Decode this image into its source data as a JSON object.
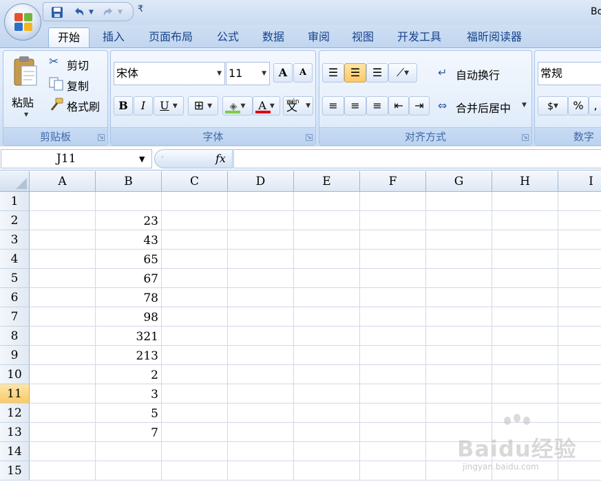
{
  "titlebar": {
    "window_title": "Bo",
    "more_glyph": "₹"
  },
  "tabs": [
    "开始",
    "插入",
    "页面布局",
    "公式",
    "数据",
    "审阅",
    "视图",
    "开发工具",
    "福昕阅读器"
  ],
  "clipboard": {
    "paste": "粘贴",
    "cut": "剪切",
    "copy": "复制",
    "format_painter": "格式刷",
    "label": "剪贴板"
  },
  "font": {
    "name": "宋体",
    "size": "11",
    "grow_glyph": "A",
    "shrink_glyph": "A",
    "bold": "B",
    "italic": "I",
    "underline": "U",
    "font_color_glyph": "A",
    "phonetic_top": "wén",
    "phonetic_glyph": "文",
    "label": "字体",
    "fill_color": "#7bd03c",
    "font_color": "#e00000"
  },
  "alignment": {
    "wrap_text": "自动换行",
    "merge_center": "合并后居中",
    "label": "对齐方式"
  },
  "number": {
    "format": "常规",
    "percent": "%",
    "label": "数字"
  },
  "formula_bar": {
    "name_box": "J11",
    "fx": "fx",
    "formula": ""
  },
  "sheet": {
    "columns": [
      "A",
      "B",
      "C",
      "D",
      "E",
      "F",
      "G",
      "H",
      "I"
    ],
    "rows": [
      "1",
      "2",
      "3",
      "4",
      "5",
      "6",
      "7",
      "8",
      "9",
      "10",
      "11",
      "12",
      "13",
      "14",
      "15"
    ],
    "active_row": "11",
    "column_b_values": [
      "",
      "23",
      "43",
      "65",
      "67",
      "78",
      "98",
      "321",
      "213",
      "2",
      "3",
      "5",
      "7",
      "",
      ""
    ]
  },
  "watermark": {
    "brand": "Baidu经验",
    "url": "jingyan.baidu.com"
  }
}
